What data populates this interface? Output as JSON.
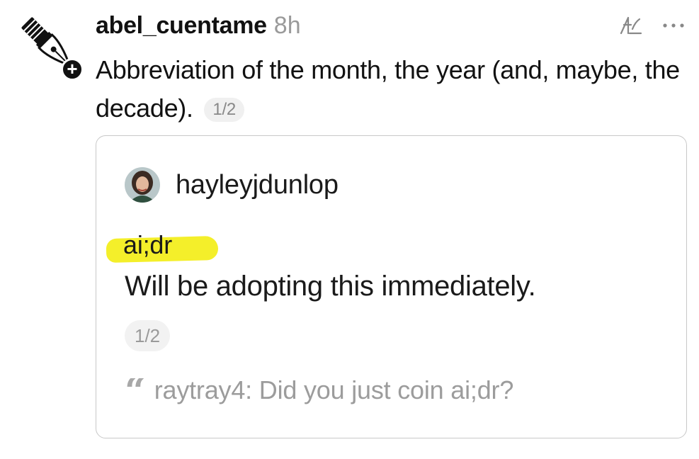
{
  "post": {
    "username": "abel_cuentame",
    "timestamp": "8h",
    "text": "Abbreviation of the month, the year (and, maybe, the decade).",
    "pager": "1/2",
    "avatar_icon": "fountain-pen-nib-icon",
    "follow_icon": "plus-icon"
  },
  "header_actions": {
    "translate_icon": "translate-icon",
    "more_icon": "more-options-icon"
  },
  "quoted_post": {
    "username": "hayleyjdunlop",
    "highlight_text": "ai;dr",
    "text": "Will be adopting this immediately.",
    "pager": "1/2",
    "quote_icon": "quote-icon",
    "quote_line": "raytray4: Did you just coin ai;dr?",
    "highlight_color": "#f4ef2a"
  }
}
